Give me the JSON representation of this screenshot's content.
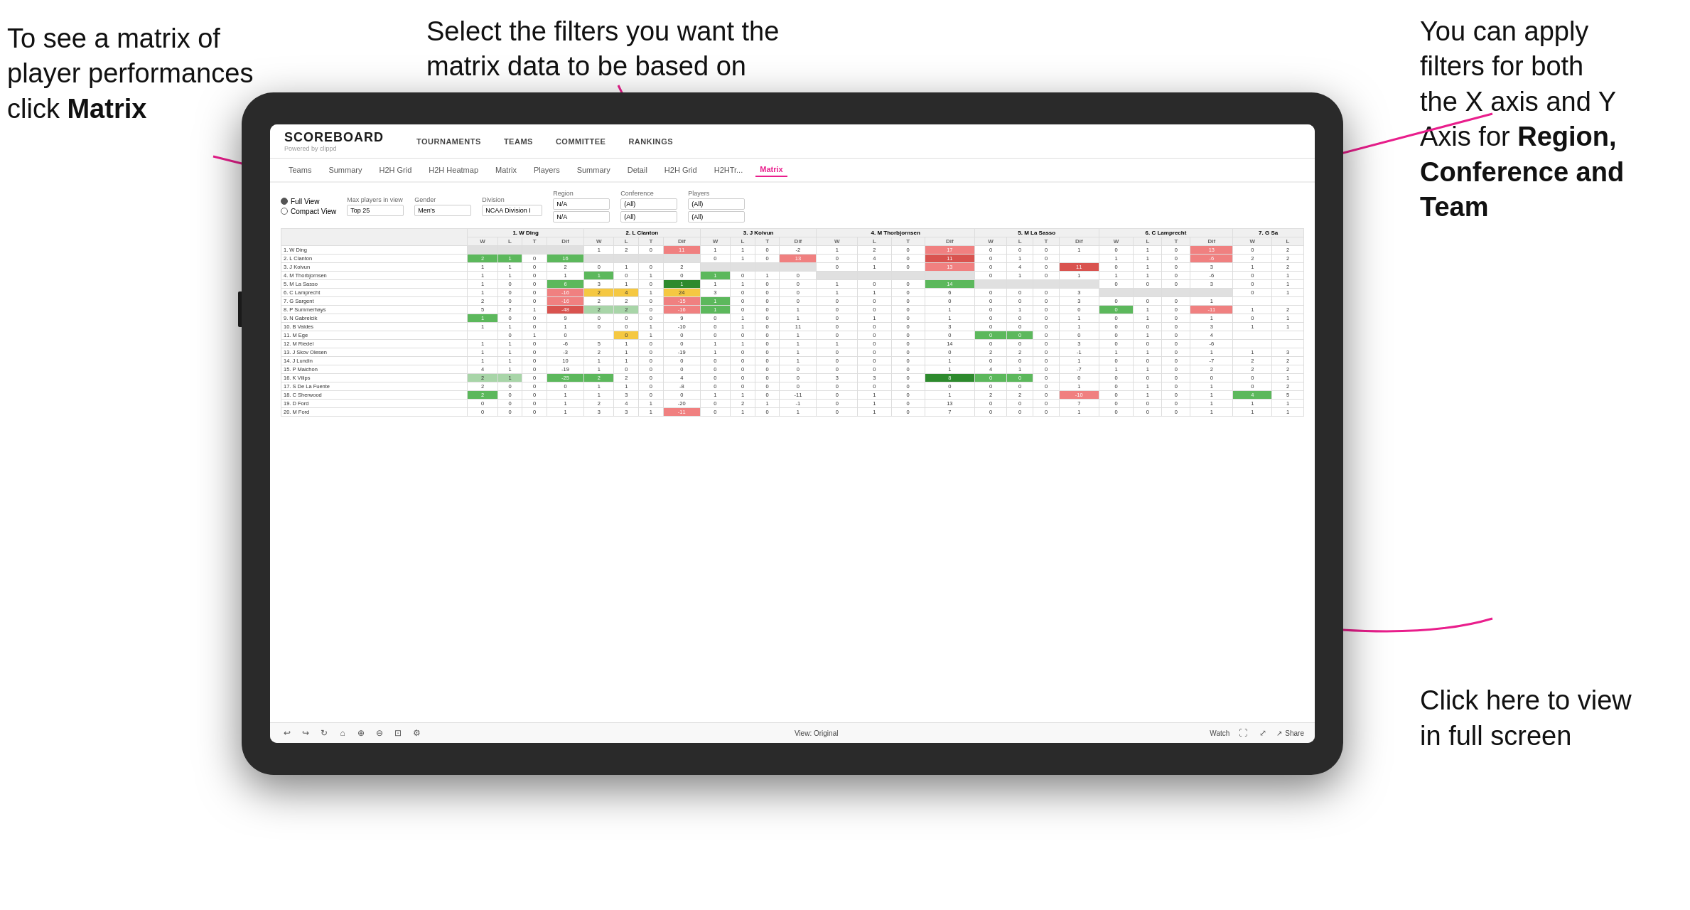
{
  "annotations": {
    "top_left": {
      "line1": "To see a matrix of",
      "line2": "player performances",
      "line3": "click ",
      "bold": "Matrix"
    },
    "top_mid": {
      "line1": "Select the filters you want the",
      "line2": "matrix data to be based on"
    },
    "top_right": {
      "line1": "You  can apply",
      "line2": "filters for both",
      "line3": "the X axis and Y",
      "line4_pre": "Axis for ",
      "line4_bold": "Region,",
      "line5_bold": "Conference and",
      "line6_bold": "Team"
    },
    "bottom_right": {
      "line1": "Click here to view",
      "line2": "in full screen"
    }
  },
  "app": {
    "brand": "SCOREBOARD",
    "powered_by": "Powered by clippd",
    "nav": [
      "TOURNAMENTS",
      "TEAMS",
      "COMMITTEE",
      "RANKINGS"
    ],
    "sub_nav": [
      "Teams",
      "Summary",
      "H2H Grid",
      "H2H Heatmap",
      "Matrix",
      "Players",
      "Summary",
      "Detail",
      "H2H Grid",
      "H2HTr...",
      "Matrix"
    ],
    "active_sub_nav": "Matrix"
  },
  "filters": {
    "view_options": [
      "Full View",
      "Compact View"
    ],
    "active_view": "Full View",
    "max_players_label": "Max players in view",
    "max_players_value": "Top 25",
    "gender_label": "Gender",
    "gender_value": "Men's",
    "division_label": "Division",
    "division_value": "NCAA Division I",
    "region_label": "Region",
    "region_values": [
      "N/A",
      "N/A"
    ],
    "conference_label": "Conference",
    "conference_values": [
      "(All)",
      "(All)"
    ],
    "players_label": "Players",
    "players_values": [
      "(All)",
      "(All)"
    ]
  },
  "matrix": {
    "col_headers": [
      "1. W Ding",
      "2. L Clanton",
      "3. J Koivun",
      "4. M Thorbjornsen",
      "5. M La Sasso",
      "6. C Lamprecht",
      "7. G Sa"
    ],
    "sub_headers": [
      "W",
      "L",
      "T",
      "Dif"
    ],
    "rows": [
      {
        "name": "1. W Ding"
      },
      {
        "name": "2. L Clanton"
      },
      {
        "name": "3. J Koivun"
      },
      {
        "name": "4. M Thorbjornsen"
      },
      {
        "name": "5. M La Sasso"
      },
      {
        "name": "6. C Lamprecht"
      },
      {
        "name": "7. G Sargent"
      },
      {
        "name": "8. P Summerhays"
      },
      {
        "name": "9. N Gabrelcik"
      },
      {
        "name": "10. B Valdes"
      },
      {
        "name": "11. M Ege"
      },
      {
        "name": "12. M Riedel"
      },
      {
        "name": "13. J Skov Olesen"
      },
      {
        "name": "14. J Lundin"
      },
      {
        "name": "15. P Maichon"
      },
      {
        "name": "16. K Vilips"
      },
      {
        "name": "17. S De La Fuente"
      },
      {
        "name": "18. C Sherwood"
      },
      {
        "name": "19. D Ford"
      },
      {
        "name": "20. M Ford"
      }
    ]
  },
  "toolbar": {
    "view_label": "View: Original",
    "watch_label": "Watch",
    "share_label": "Share"
  }
}
